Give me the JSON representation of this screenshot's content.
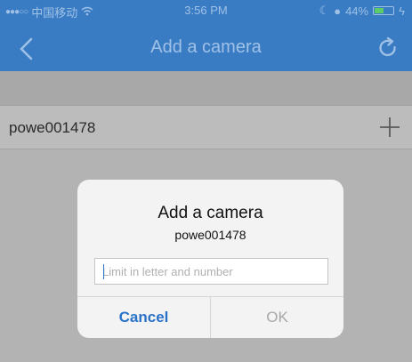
{
  "status_bar": {
    "carrier": "中国移动",
    "time": "3:56 PM",
    "battery": "44%",
    "battery_level": 0.44
  },
  "nav": {
    "title": "Add a camera",
    "back_icon": "chevron-left-icon",
    "refresh_icon": "refresh-icon"
  },
  "list": {
    "items": [
      {
        "label": "powe001478",
        "action_icon": "plus-icon"
      }
    ]
  },
  "dialog": {
    "title": "Add a camera",
    "subtitle": "powe001478",
    "input_value": "",
    "input_placeholder": "Limit in letter and number",
    "cancel_label": "Cancel",
    "ok_label": "OK"
  },
  "colors": {
    "header": "#3a7cc4",
    "accent": "#2a72c9",
    "disabled": "#a8a8a8"
  }
}
